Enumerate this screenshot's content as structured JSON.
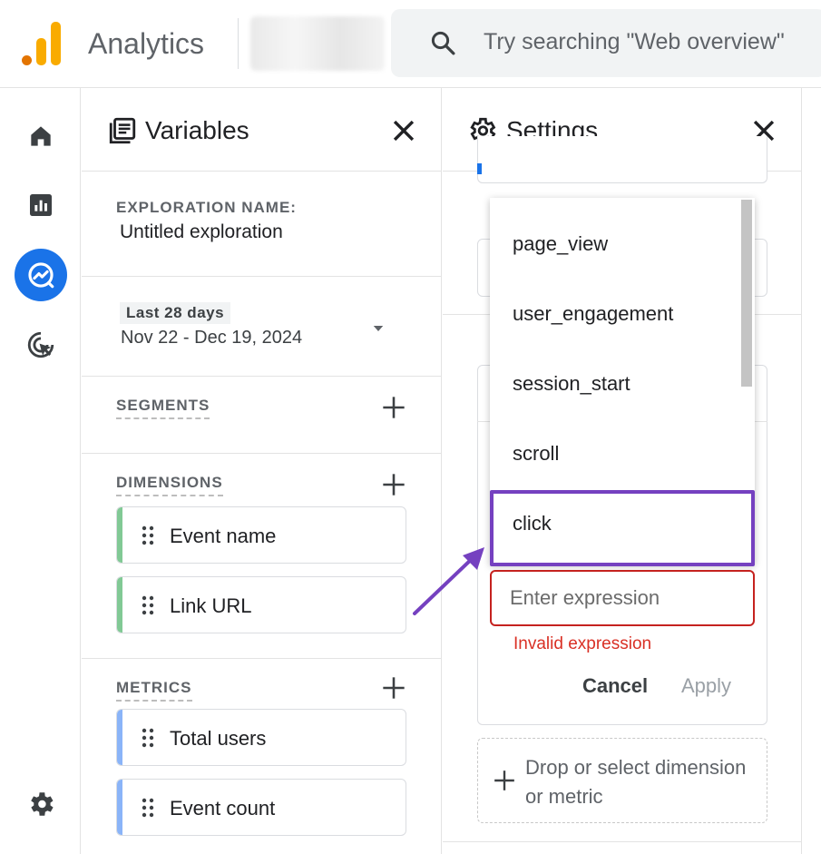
{
  "app": {
    "title": "Analytics"
  },
  "search": {
    "placeholder": "Try searching \"Web overview\""
  },
  "variables_panel": {
    "title": "Variables",
    "exploration": {
      "label": "EXPLORATION NAME:",
      "value": "Untitled exploration"
    },
    "date_range": {
      "badge": "Last 28 days",
      "range": "Nov 22 - Dec 19, 2024"
    },
    "segments": {
      "label": "SEGMENTS"
    },
    "dimensions": {
      "label": "DIMENSIONS",
      "items": [
        "Event name",
        "Link URL"
      ],
      "accent": "#81c995"
    },
    "metrics": {
      "label": "METRICS",
      "items": [
        "Total users",
        "Event count"
      ],
      "accent": "#8ab4f8"
    }
  },
  "settings_panel": {
    "title": "Settings",
    "dropdown": {
      "options": [
        "page_view",
        "user_engagement",
        "session_start",
        "scroll",
        "click"
      ],
      "highlighted": "click"
    },
    "expression": {
      "placeholder": "Enter expression",
      "error": "Invalid expression"
    },
    "buttons": {
      "cancel": "Cancel",
      "apply": "Apply"
    },
    "drop_zone": {
      "text": "Drop or select dimension or metric"
    }
  },
  "colors": {
    "accent": "#1a73e8",
    "highlight": "#7541c0",
    "error": "#d93025"
  },
  "icons": [
    "search-icon",
    "home-icon",
    "reports-icon",
    "explore-icon",
    "advertising-icon",
    "admin-gear-icon",
    "variables-icon",
    "settings-gear-icon",
    "close-icon",
    "plus-icon",
    "drag-handle-icon",
    "dropdown-arrow-icon"
  ]
}
